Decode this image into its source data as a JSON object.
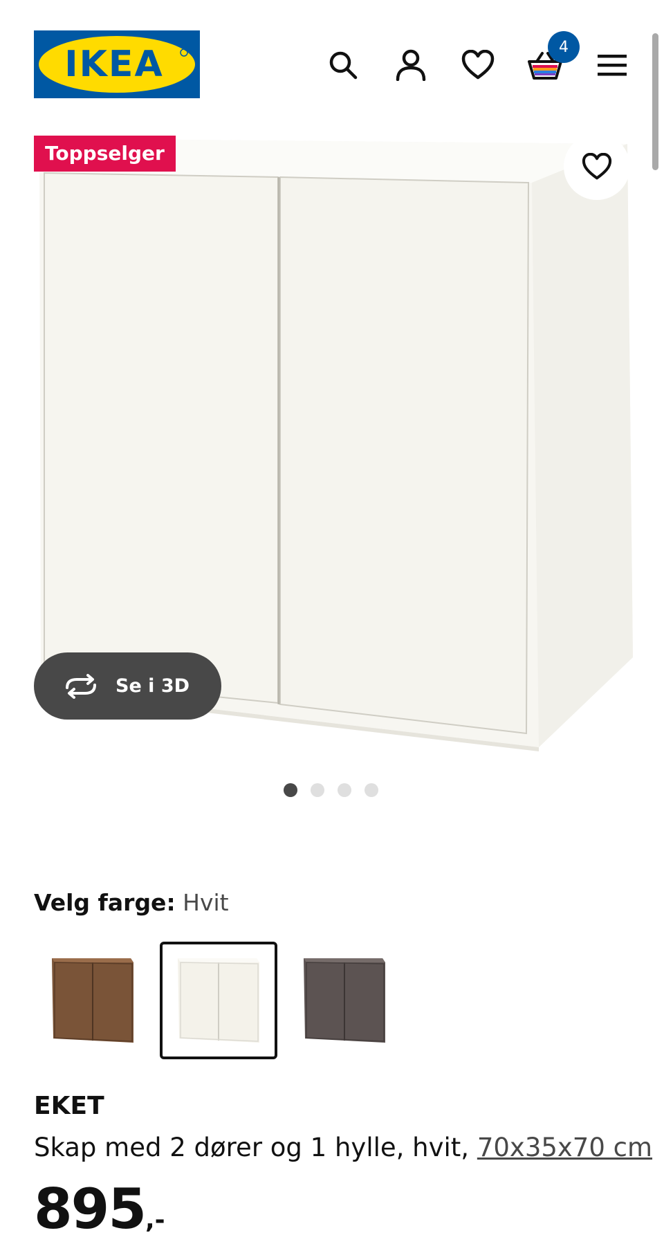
{
  "header": {
    "logo_text": "IKEA",
    "icons": [
      "search-icon",
      "account-icon",
      "wishlist-heart-icon",
      "cart-basket-icon",
      "hamburger-menu-icon"
    ],
    "cart_count": "4"
  },
  "gallery": {
    "badge": "Toppselger",
    "favorite_icon": "heart-icon",
    "view_3d_label": "Se i 3D",
    "view_3d_icon": "rotate-3d-icon",
    "image_count": 4,
    "active_image": 1
  },
  "colors": {
    "label": "Velg farge:",
    "selected_value": "Hvit",
    "options": [
      {
        "name": "walnut-effect",
        "color": "#7a5438",
        "selected": false
      },
      {
        "name": "white",
        "color": "#f4f2ea",
        "selected": true
      },
      {
        "name": "dark-grey",
        "color": "#5c5352",
        "selected": false
      }
    ]
  },
  "product": {
    "name": "EKET",
    "description": "Skap med 2 dører og 1 hylle, hvit, ",
    "measurement": "70x35x70 cm",
    "price": "895",
    "price_suffix": ",-"
  },
  "theme": {
    "ikea_blue": "#0058a3",
    "ikea_yellow": "#ffdb00",
    "badge_red": "#e0104e",
    "dark_grey": "#484848"
  }
}
